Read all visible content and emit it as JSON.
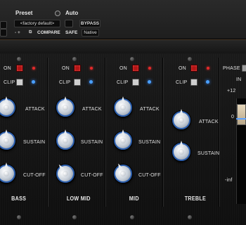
{
  "header": {
    "preset_label": "Preset",
    "auto_label": "Auto",
    "preset_value": "<factory default>",
    "compare_label": "COMPARE",
    "plus_minus": "- +",
    "bypass_label": "BYPASS",
    "safe_label": "SAFE",
    "native_label": "Native"
  },
  "channels": [
    {
      "on_label": "ON",
      "clip_label": "CLIP",
      "attack_label": "ATTACK",
      "sustain_label": "SUSTAIN",
      "cutoff_label": "CUT-OFF",
      "band_label": "BASS"
    },
    {
      "on_label": "ON",
      "clip_label": "CLIP",
      "attack_label": "ATTACK",
      "sustain_label": "SUSTAIN",
      "cutoff_label": "CUT-OFF",
      "band_label": "LOW MID"
    },
    {
      "on_label": "ON",
      "clip_label": "CLIP",
      "attack_label": "ATTACK",
      "sustain_label": "SUSTAIN",
      "cutoff_label": "CUT-OFF",
      "band_label": "MID"
    },
    {
      "on_label": "ON",
      "clip_label": "CLIP",
      "attack_label": "ATTACK",
      "sustain_label": "SUSTAIN",
      "band_label": "TREBLE"
    }
  ],
  "output": {
    "phase_label": "PHASE",
    "in_label": "IN",
    "scale_top": "+12",
    "scale_mid": "0",
    "scale_bottom": "-inf"
  },
  "colors": {
    "knob_ring": "#2c5fae",
    "on_button": "#b01515",
    "clip_led": "#4aa0ff"
  }
}
